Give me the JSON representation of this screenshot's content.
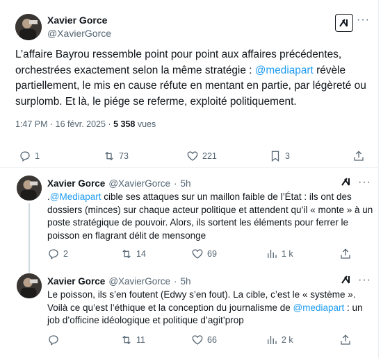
{
  "main_tweet": {
    "author_name": "Xavier Gorce",
    "author_handle": "@XavierGorce",
    "text_part1": "L’affaire Bayrou ressemble point pour point aux affaires précédentes, orchestrées exactement selon la même stratégie : ",
    "mention": "@mediapart",
    "text_part2": " révèle partiellement, le mis en cause réfute en mentant en partie, par légèreté ou surplomb. Et là, le piége se referme, exploité politiquement.",
    "time": "1:47 PM",
    "date": "16 févr. 2025",
    "views_count": "5 358",
    "views_label": "vues",
    "replies": "1",
    "reposts": "73",
    "likes": "221",
    "bookmarks": "3"
  },
  "replies": [
    {
      "author_name": "Xavier Gorce",
      "author_handle": "@XavierGorce",
      "age": "5h",
      "text_prefix": ".",
      "mention": "@Mediapart",
      "text_rest": " cible ses attaques sur un maillon faible de l’État : ils ont des dossiers (minces) sur chaque acteur politique et attendent qu’il « monte » à un poste stratégique de pouvoir. Alors, ils sortent les éléments pour ferrer le poisson en flagrant délit de mensonge",
      "replies": "2",
      "reposts": "14",
      "likes": "69",
      "views": "1 k"
    },
    {
      "author_name": "Xavier Gorce",
      "author_handle": "@XavierGorce",
      "age": "5h",
      "text_prefix": "Le poisson, ils s’en foutent (Edwy s’en fout). La cible, c’est le « système ». Voilà ce qu’est l’éthique et la conception du journalisme de ",
      "mention": "@mediapart",
      "text_rest": " : un job d’officine idéologique et politique d’agit’prop",
      "replies": "",
      "reposts": "11",
      "likes": "66",
      "views": "2 k"
    }
  ],
  "icons": {
    "grok": "grok-icon",
    "more": "more-icon",
    "reply": "reply-icon",
    "repost": "repost-icon",
    "like": "heart-icon",
    "views": "views-icon",
    "bookmark": "bookmark-icon",
    "share": "share-icon"
  },
  "colors": {
    "link": "#1d9bf0",
    "muted": "#536471",
    "text": "#0f1419"
  }
}
